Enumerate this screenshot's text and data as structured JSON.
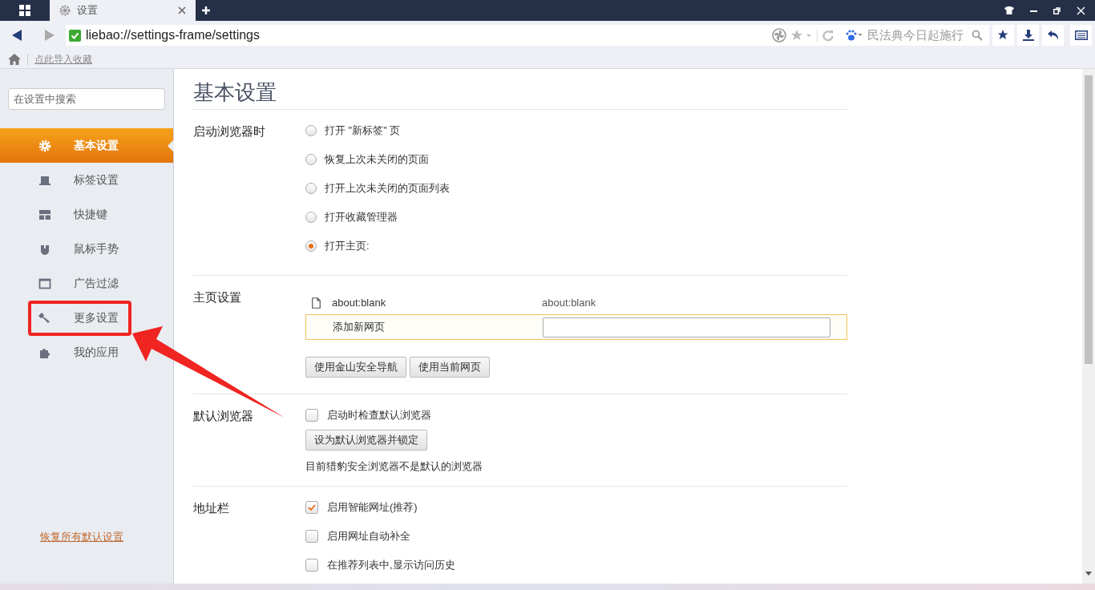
{
  "tab": {
    "title": "设置"
  },
  "address_bar": {
    "url": "liebao://settings-frame/settings",
    "search_hint": "民法典今日起施行"
  },
  "bookmarks_bar": {
    "import_link": "点此导入收藏"
  },
  "sidebar": {
    "search": {
      "placeholder": "在设置中搜索"
    },
    "items": [
      {
        "label": "基本设置",
        "selected": true
      },
      {
        "label": "标签设置",
        "selected": false
      },
      {
        "label": "快捷键",
        "selected": false
      },
      {
        "label": "鼠标手势",
        "selected": false
      },
      {
        "label": "广告过滤",
        "selected": false
      },
      {
        "label": "更多设置",
        "selected": false
      },
      {
        "label": "我的应用",
        "selected": false
      }
    ],
    "restore_link": "恢复所有默认设置"
  },
  "page": {
    "title": "基本设置",
    "sections": [
      {
        "kind": "startup",
        "label": "启动浏览器时",
        "options": [
          {
            "label": "打开 \"新标签\" 页",
            "selected": false
          },
          {
            "label": "恢复上次未关闭的页面",
            "selected": false
          },
          {
            "label": "打开上次未关闭的页面列表",
            "selected": false
          },
          {
            "label": "打开收藏管理器",
            "selected": false
          },
          {
            "label": "打开主页:",
            "selected": true
          }
        ]
      },
      {
        "kind": "homepage",
        "label": "主页设置",
        "pages": [
          {
            "title": "about:blank",
            "url": "about:blank"
          }
        ],
        "add_label": "添加新网页",
        "buttons": [
          "使用金山安全导航",
          "使用当前网页"
        ]
      },
      {
        "kind": "default",
        "label": "默认浏览器",
        "checks": [
          {
            "label": "启动时检查默认浏览器",
            "checked": false
          }
        ],
        "button": "设为默认浏览器并锁定",
        "note": "目前猎豹安全浏览器不是默认的浏览器"
      },
      {
        "kind": "address",
        "label": "地址栏",
        "checks": [
          {
            "label": "启用智能网址(推荐)",
            "checked": true
          },
          {
            "label": "启用网址自动补全",
            "checked": false
          },
          {
            "label": "在推荐列表中,显示访问历史",
            "checked": false
          }
        ]
      }
    ]
  }
}
